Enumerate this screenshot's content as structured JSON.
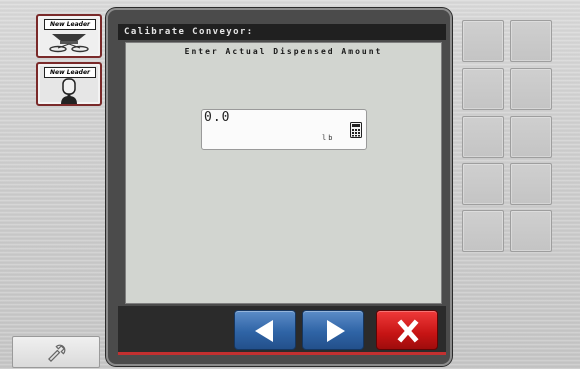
{
  "app_buttons": [
    {
      "logo_text": "New Leader",
      "icon": "spreader-icon"
    },
    {
      "logo_text": "New Leader",
      "icon": "joystick-icon"
    }
  ],
  "tools": {
    "icon": "wrench-icon"
  },
  "dialog": {
    "title": "Calibrate Conveyor:",
    "prompt": "Enter Actual Dispensed Amount",
    "field": {
      "value": "0.0",
      "unit": "lb",
      "icon": "calculator-icon"
    }
  },
  "buttons": {
    "back": {
      "icon": "left-arrow-icon"
    },
    "next": {
      "icon": "right-arrow-icon"
    },
    "cancel": {
      "icon": "close-icon"
    }
  },
  "colors": {
    "title_bar": "#202020",
    "dialog_bg": "#d2d5d0",
    "nav_blue": "#2f64a6",
    "cancel_red": "#c61414",
    "accent_line": "#c23030"
  }
}
